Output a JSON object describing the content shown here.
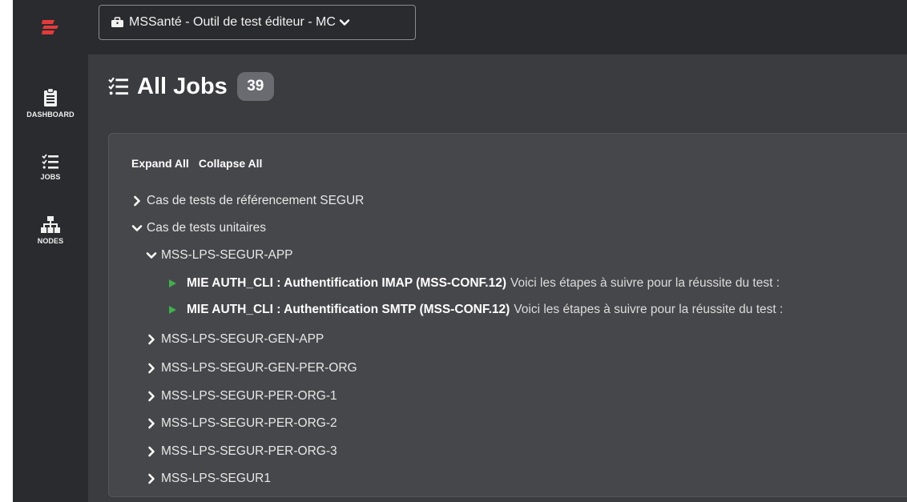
{
  "header": {
    "project_label": "MSSanté - Outil de test éditeur - MC"
  },
  "sidebar": {
    "items": [
      {
        "label": "DASHBOARD",
        "icon": "clipboard-icon"
      },
      {
        "label": "JOBS",
        "icon": "tasks-list-icon"
      },
      {
        "label": "NODES",
        "icon": "sitemap-icon"
      }
    ]
  },
  "page": {
    "title": "All Jobs",
    "count": "39"
  },
  "panel": {
    "expand_all": "Expand All",
    "collapse_all": "Collapse All"
  },
  "tree": {
    "groups": [
      {
        "label": "Cas de tests de référencement SEGUR",
        "expanded": false
      },
      {
        "label": "Cas de tests unitaires",
        "expanded": true
      }
    ],
    "subgroups": [
      {
        "label": "MSS-LPS-SEGUR-APP",
        "expanded": true
      },
      {
        "label": "MSS-LPS-SEGUR-GEN-APP",
        "expanded": false
      },
      {
        "label": "MSS-LPS-SEGUR-GEN-PER-ORG",
        "expanded": false
      },
      {
        "label": "MSS-LPS-SEGUR-PER-ORG-1",
        "expanded": false
      },
      {
        "label": "MSS-LPS-SEGUR-PER-ORG-2",
        "expanded": false
      },
      {
        "label": "MSS-LPS-SEGUR-PER-ORG-3",
        "expanded": false
      },
      {
        "label": "MSS-LPS-SEGUR1",
        "expanded": false
      }
    ],
    "jobs": [
      {
        "name": "MIE AUTH_CLI : Authentification IMAP (MSS-CONF.12)",
        "description": "Voici les étapes à suivre pour la réussite du test :"
      },
      {
        "name": "MIE AUTH_CLI : Authentification SMTP (MSS-CONF.12)",
        "description": "Voici les étapes à suivre pour la réussite du test :"
      }
    ]
  },
  "colors": {
    "brand_red": "#e63a3a",
    "run_green": "#3db24a",
    "sidebar_bg": "#2a2b2e",
    "content_bg": "#3b3c40",
    "panel_bg": "#46474b"
  }
}
